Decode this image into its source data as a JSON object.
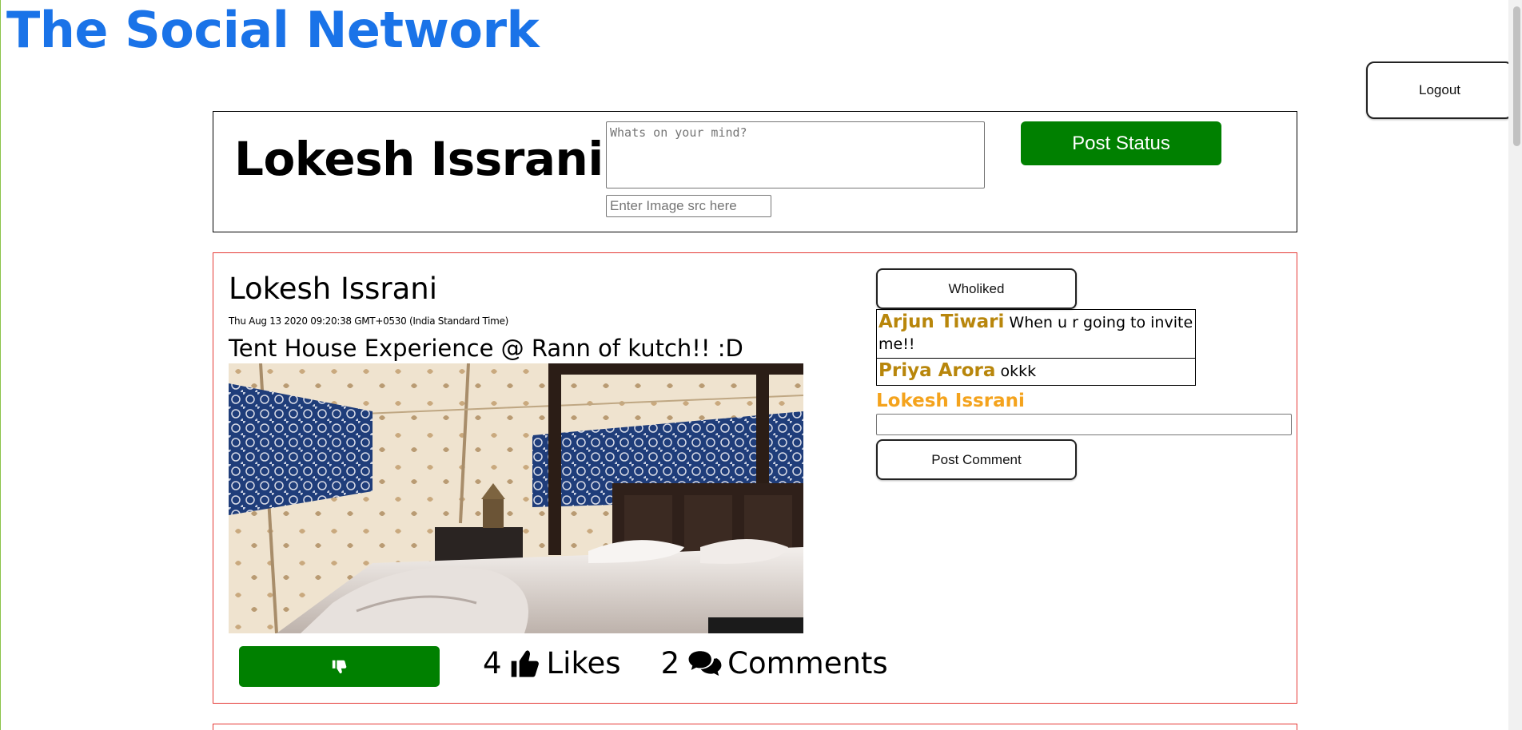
{
  "site": {
    "title": "The Social Network"
  },
  "header": {
    "logout_label": "Logout"
  },
  "composer": {
    "user_name": "Lokesh Issrani",
    "status_placeholder": "Whats on your mind?",
    "image_placeholder": "Enter Image src here",
    "post_button_label": "Post Status"
  },
  "post": {
    "author": "Lokesh Issrani",
    "timestamp": "Thu Aug 13 2020 09:20:38 GMT+0530 (India Standard Time)",
    "text": "Tent House Experience @ Rann of kutch!! :D",
    "image_alt": "tent interior with bed",
    "likes_count": "4",
    "likes_label": "Likes",
    "comments_count": "2",
    "comments_label": "Comments",
    "like_button_icon": "thumbs-down-icon",
    "who_liked_label": "Wholiked",
    "comments": [
      {
        "name": "Arjun Tiwari",
        "text": "When u r going to invite me!!"
      },
      {
        "name": "Priya Arora",
        "text": "okkk"
      }
    ],
    "current_user": "Lokesh Issrani",
    "post_comment_label": "Post Comment"
  },
  "colors": {
    "title_blue": "#1a73e8",
    "primary_green": "#008000",
    "card_border_red": "#e53935",
    "comment_name_gold": "#b8860b",
    "current_user_orange": "#f4a31d"
  }
}
